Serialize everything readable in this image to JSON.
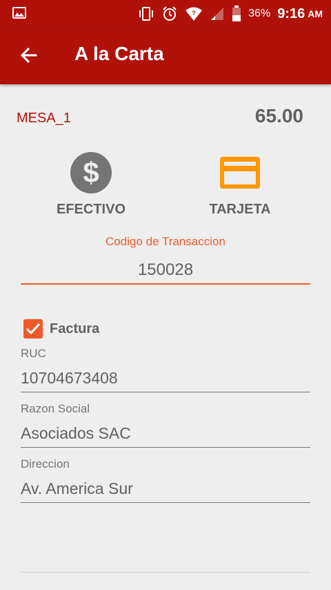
{
  "status_bar": {
    "battery_percent": "36%",
    "time": "9:16",
    "ampm": "AM"
  },
  "app_bar": {
    "title": "A la Carta",
    "back_icon": "arrow-back-icon"
  },
  "order": {
    "table": "MESA_1",
    "total": "65.00"
  },
  "payment_methods": [
    {
      "label": "EFECTIVO",
      "icon": "dollar-circle-icon",
      "color": "#757575"
    },
    {
      "label": "TARJETA",
      "icon": "credit-card-icon",
      "color": "#ff9800"
    }
  ],
  "transaction": {
    "label": "Codigo de Transaccion",
    "value": "150028"
  },
  "invoice": {
    "checkbox_label": "Factura",
    "checked": true,
    "fields": [
      {
        "label": "RUC",
        "value": "10704673408"
      },
      {
        "label": "Razon Social",
        "value": "Asociados SAC"
      },
      {
        "label": "Direccion",
        "value": "Av. America Sur"
      }
    ]
  },
  "colors": {
    "primary": "#b0120a",
    "accent": "#ef5a2a",
    "text_gray": "#616161"
  }
}
